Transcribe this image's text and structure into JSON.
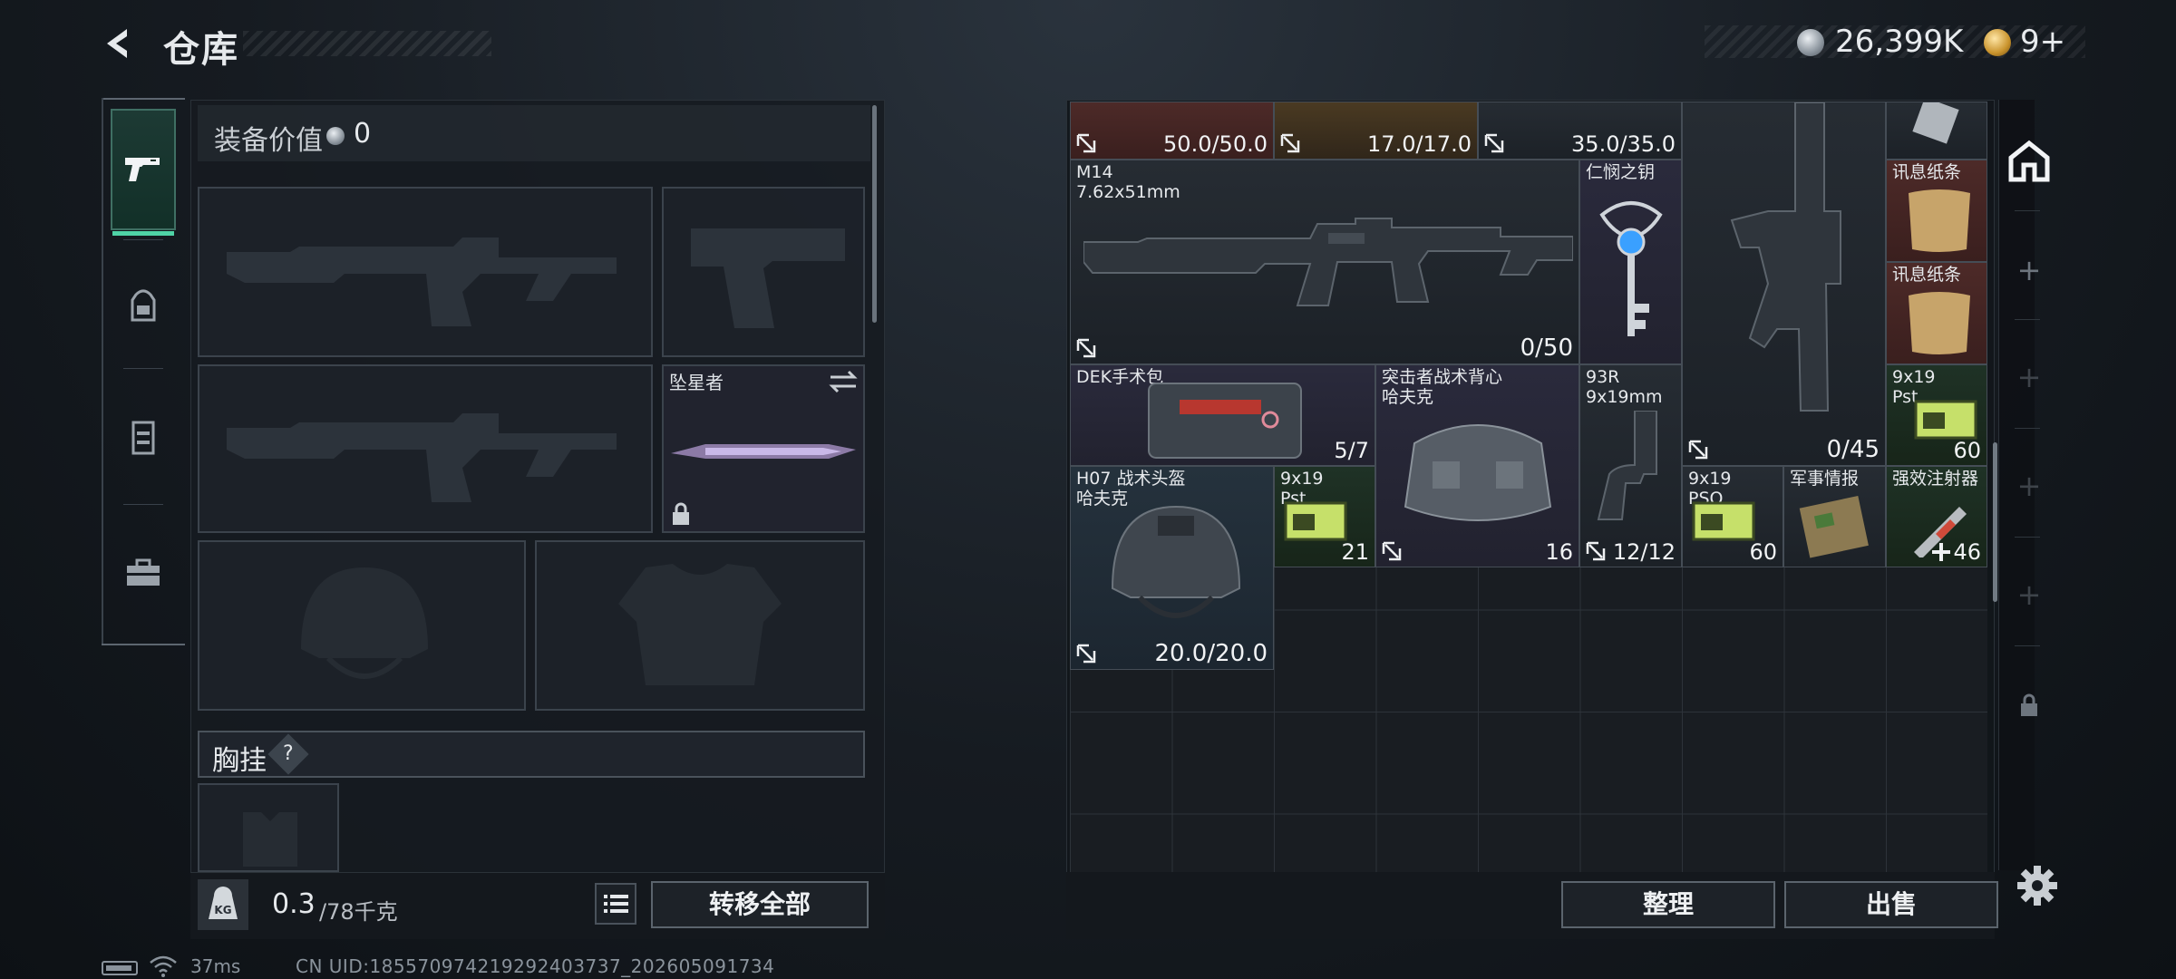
{
  "header": {
    "title": "仓库",
    "currency": [
      {
        "icon": "silver-coin-icon",
        "value": "26,399K"
      },
      {
        "icon": "gold-coin-icon",
        "value": "9+"
      }
    ]
  },
  "nav": {
    "tabs": [
      {
        "icon": "pistol-icon",
        "active": true
      },
      {
        "icon": "backpack-icon",
        "active": false
      },
      {
        "icon": "vest-icon",
        "active": false
      },
      {
        "icon": "toolbox-icon",
        "active": false
      }
    ]
  },
  "equipment": {
    "value_label": "装备价值",
    "value": "0",
    "melee_name": "坠星者",
    "chest_rig_label": "胸挂",
    "help": "?",
    "weight": "0.3",
    "weight_max": "/78千克",
    "transfer_all": "转移全部"
  },
  "grid": {
    "items": [
      {
        "name": "",
        "qty": "50.0/50.0",
        "bg": "red"
      },
      {
        "name": "",
        "qty": "17.0/17.0",
        "bg": "gold"
      },
      {
        "name": "",
        "qty": "35.0/35.0",
        "bg": "dark"
      },
      {
        "name": "M14\n7.62x51mm",
        "qty": "0/50",
        "bg": "dark"
      },
      {
        "name": "仁悯之钥",
        "qty": "",
        "bg": "purple"
      },
      {
        "name": "",
        "qty": "0/45",
        "bg": "dark"
      },
      {
        "name": "讯息纸条",
        "qty": "",
        "bg": "red"
      },
      {
        "name": "讯息纸条",
        "qty": "",
        "bg": "red"
      },
      {
        "name": "DEK手术包",
        "qty": "5/7",
        "bg": "purple"
      },
      {
        "name": "突击者战术背心\n哈夫克",
        "qty": "16",
        "bg": "purple"
      },
      {
        "name": "93R\n9x19mm",
        "qty": "12/12",
        "bg": "dark"
      },
      {
        "name": "9x19\nPst",
        "qty": "60",
        "bg": "green"
      },
      {
        "name": "H07 战术头盔\n哈夫克",
        "qty": "20.0/20.0",
        "bg": "blue"
      },
      {
        "name": "9x19\nPst",
        "qty": "21",
        "bg": "green"
      },
      {
        "name": "9x19\nPSO",
        "qty": "60",
        "bg": "dark"
      },
      {
        "name": "军事情报",
        "qty": "",
        "bg": "dark"
      },
      {
        "name": "强效注射器",
        "qty": "46",
        "bg": "green"
      }
    ],
    "sort_label": "整理",
    "sell_label": "出售"
  },
  "status": {
    "ping": "37ms",
    "uid": "CN UID:1855709742192924037​37_202605091734"
  },
  "colors": {
    "accent": "#4fd3a6",
    "panel": "#161b21"
  }
}
